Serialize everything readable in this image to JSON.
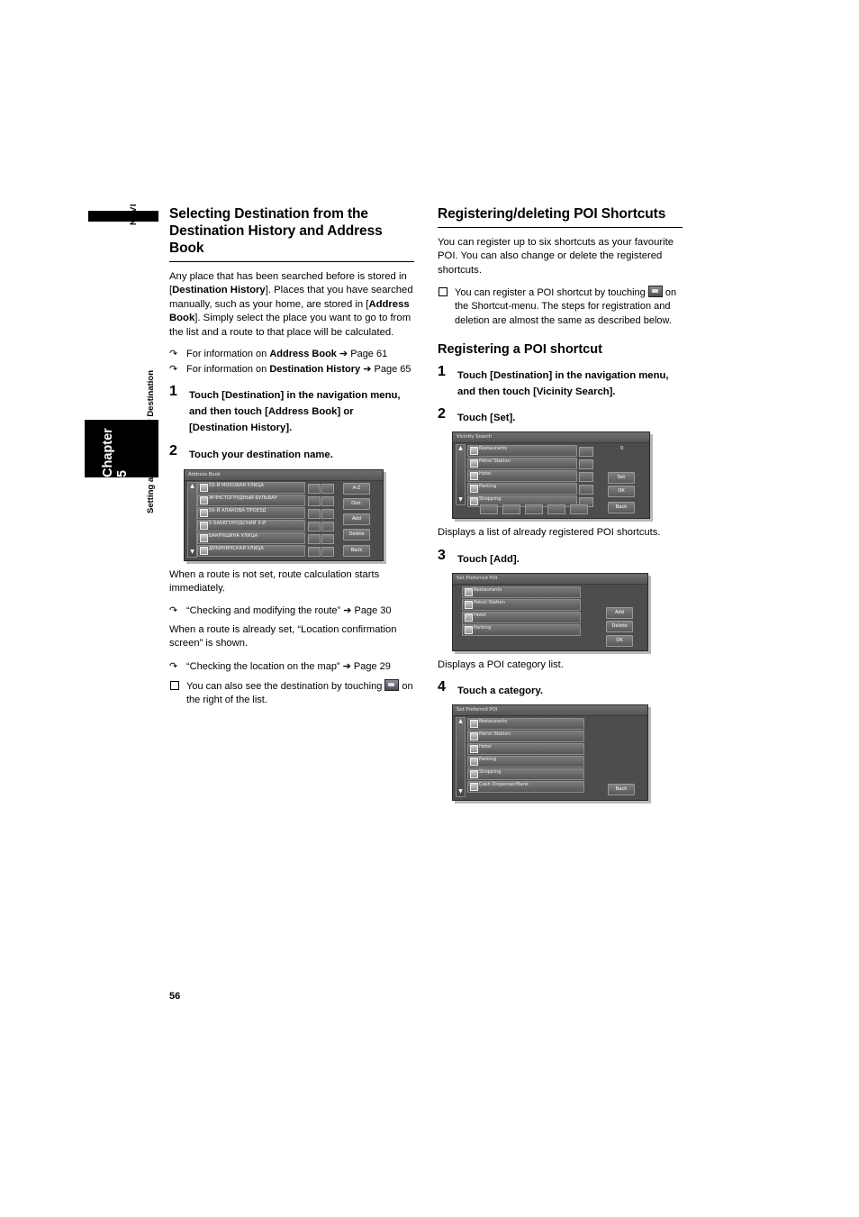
{
  "margin": {
    "navi_label": "NAVI",
    "chapter_label": "Chapter 5",
    "running_head": "Setting a Route to Your Destination",
    "page_number": "56"
  },
  "left_column": {
    "heading": "Selecting Destination from the Destination History and Address Book",
    "intro_1": "Any place that has been searched before is stored in [",
    "intro_1_b1": "Destination History",
    "intro_1_mid": "]. Places that you have searched manually, such as your home, are stored in [",
    "intro_1_b2": "Address Book",
    "intro_1_end": "]. Simply select the place you want to go to from the list and a route to that place will be calculated.",
    "ref_1_pre": "For information on ",
    "ref_1_b": "Address Book",
    "ref_1_post": " ➔ Page 61",
    "ref_2_pre": "For information on ",
    "ref_2_b": "Destination History",
    "ref_2_post": " ➔ Page 65",
    "step_1_num": "1",
    "step_1_text": "Touch [Destination] in the navigation menu, and then touch [Address Book] or [Destination History].",
    "step_2_num": "2",
    "step_2_text": "Touch your destination name.",
    "cap_1": "When a route is not set, route calculation starts immediately.",
    "ref_3": "“Checking and modifying the route” ➔ Page 30",
    "cap_2": "When a route is already set, “Location confirmation screen” is shown.",
    "ref_4": "“Checking the location on the map” ➔ Page 29",
    "note_1_pre": "You can also see the destination by touching ",
    "note_1_post": " on the right of the list."
  },
  "right_column": {
    "heading": "Registering/deleting POI Shortcuts",
    "intro": "You can register up to six shortcuts as your favourite POI. You can also change or delete the registered shortcuts.",
    "note_pre": "You can register a POI shortcut by touching ",
    "note_post": " on the Shortcut-menu. The steps for registration and deletion are almost the same as described below.",
    "subheading": "Registering a POI shortcut",
    "step_1_num": "1",
    "step_1_text": "Touch [Destination] in the navigation menu, and then touch [Vicinity Search].",
    "step_2_num": "2",
    "step_2_text": "Touch [Set].",
    "cap_2": "Displays a list of already registered POI shortcuts.",
    "step_3_num": "3",
    "step_3_text": "Touch [Add].",
    "cap_3": "Displays a POI category list.",
    "step_4_num": "4",
    "step_4_text": "Touch a category."
  },
  "screens": {
    "address_book": {
      "title": "Address Book",
      "rows": [
        "55-Й МОХОВАЯ УЛИЦА",
        "ЖЧНСТОГРУДНЫЙ БУЛЬВАР",
        "55-Й АПАКОВА ПРОЕЗД",
        "5 БАБЕГОРОДСКИЙ 3-Й",
        "БАКРУШИНА УЛИЦА",
        "ДУБИНИНСКАЯ УЛИЦА"
      ],
      "side_buttons": [
        "A-Z",
        "Dist.",
        "Add",
        "Delete",
        "Back"
      ]
    },
    "vicinity_search": {
      "title": "Vicinity Search",
      "rows": [
        "Restaurants",
        "Petrol Station",
        "Hotel",
        "Parking",
        "Shopping"
      ],
      "counter": "0",
      "side_buttons": [
        "Set",
        "OK",
        "Back"
      ]
    },
    "set_preferred_poi_1": {
      "title": "Set Preferred POI",
      "rows": [
        "Restaurants",
        "Petrol Station",
        "Hotel",
        "Parking"
      ],
      "side_buttons": [
        "Add",
        "Delete",
        "OK"
      ]
    },
    "set_preferred_poi_2": {
      "title": "Set Preferred POI",
      "rows": [
        "Restaurants",
        "Petrol Station",
        "Hotel",
        "Parking",
        "Shopping",
        "Cash Dispenser/Bank"
      ],
      "side_buttons": [
        "Back"
      ]
    }
  }
}
